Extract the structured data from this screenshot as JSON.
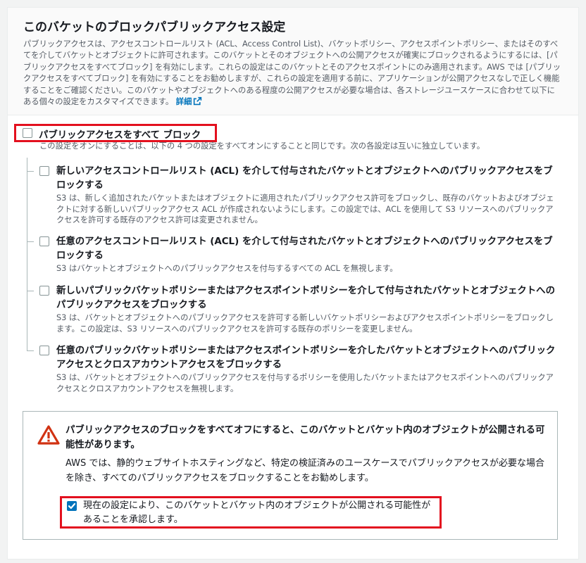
{
  "header": {
    "title": "このバケットのブロックパブリックアクセス設定",
    "description": "パブリックアクセスは、アクセスコントロールリスト (ACL、Access Control List)、バケットポリシー、アクセスポイントポリシー、またはそのすべてを介してバケットとオブジェクトに許可されます。このバケットとそのオブジェクトへの公開アクセスが確実にブロックされるようにするには、[パブリックアクセスをすべてブロック] を有効にします。これらの設定はこのバケットとそのアクセスポイントにのみ適用されます。AWS では [パブリックアクセスをすべてブロック] を有効にすることをお勧めしますが、これらの設定を適用する前に、アプリケーションが公開アクセスなしで正しく機能することをご確認ください。このバケットやオブジェクトへのある程度の公開アクセスが必要な場合は、各ストレージユースケースに合わせて以下にある個々の設定をカスタマイズできます。",
    "link_label": "詳細"
  },
  "master": {
    "label": "パブリックアクセスをすべて ブロック",
    "checked": false,
    "description": "この設定をオンにすることは、以下の 4 つの設定をすべてオンにすることと同じです。次の各設定は互いに独立しています。"
  },
  "options": [
    {
      "title": "新しいアクセスコントロールリスト (ACL) を介して付与されたバケットとオブジェクトへのパブリックアクセスをブロックする",
      "description": "S3 は、新しく追加されたバケットまたはオブジェクトに適用されたパブリックアクセス許可をブロックし、既存のバケットおよびオブジェクトに対する新しいパブリックアクセス ACL が作成されないようにします。この設定では、ACL を使用して S3 リソースへのパブリックアクセスを許可する既存のアクセス許可は変更されません。",
      "checked": false
    },
    {
      "title": "任意のアクセスコントロールリスト (ACL) を介して付与されたバケットとオブジェクトへのパブリックアクセスをブロックする",
      "description": "S3 はバケットとオブジェクトへのパブリックアクセスを付与するすべての ACL を無視します。",
      "checked": false
    },
    {
      "title": "新しいパブリックバケットポリシーまたはアクセスポイントポリシーを介して付与されたバケットとオブジェクトへのパブリックアクセスをブロックする",
      "description": "S3 は、バケットとオブジェクトへのパブリックアクセスを許可する新しいバケットポリシーおよびアクセスポイントポリシーをブロックします。この設定は、S3 リソースへのパブリックアクセスを許可する既存のポリシーを変更しません。",
      "checked": false
    },
    {
      "title": "任意のパブリックバケットポリシーまたはアクセスポイントポリシーを介したバケットとオブジェクトへのパブリックアクセスとクロスアカウントアクセスをブロックする",
      "description": "S3 は、バケットとオブジェクトへのパブリックアクセスを付与するポリシーを使用したバケットまたはアクセスポイントへのパブリックアクセスとクロスアカウントアクセスを無視します。",
      "checked": false
    }
  ],
  "warning": {
    "title": "パブリックアクセスのブロックをすべてオフにすると、このバケットとバケット内のオブジェクトが公開される可能性があります。",
    "description": "AWS では、静的ウェブサイトホスティングなど、特定の検証済みのユースケースでパブリックアクセスが必要な場合を除き、すべてのパブリックアクセスをブロックすることをお勧めします。",
    "ack_label": "現在の設定により、このバケットとバケット内のオブジェクトが公開される可能性があることを承認します。",
    "ack_checked": true
  },
  "colors": {
    "accent": "#0073bb",
    "warning": "#d13212",
    "highlight": "#e3101e"
  },
  "icons": {
    "external_link": "external-link-icon",
    "warning": "warning-icon",
    "checkmark": "checkmark-icon"
  }
}
